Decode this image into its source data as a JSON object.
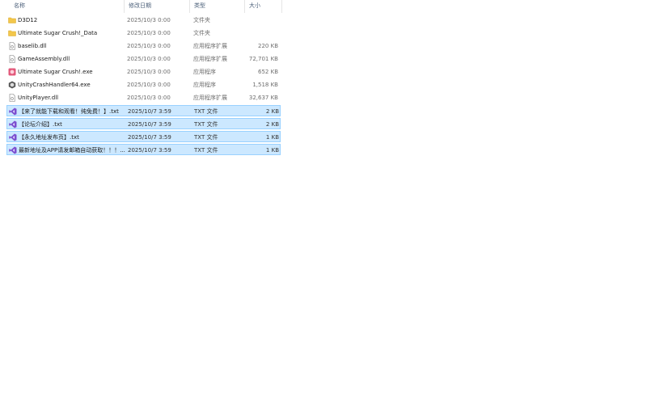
{
  "header": {
    "name": "名称",
    "date": "修改日期",
    "type": "类型",
    "size": "大小"
  },
  "rows": [
    {
      "name": "D3D12",
      "date": "2025/10/3 0:00",
      "type": "文件夹",
      "size": "",
      "icon": "folder-icon",
      "selected": false
    },
    {
      "name": "Ultimate Sugar Crush!_Data",
      "date": "2025/10/3 0:00",
      "type": "文件夹",
      "size": "",
      "icon": "folder-icon",
      "selected": false
    },
    {
      "name": "baselib.dll",
      "date": "2025/10/3 0:00",
      "type": "应用程序扩展",
      "size": "220 KB",
      "icon": "dll-file-icon",
      "selected": false
    },
    {
      "name": "GameAssembly.dll",
      "date": "2025/10/3 0:00",
      "type": "应用程序扩展",
      "size": "72,701 KB",
      "icon": "dll-file-icon",
      "selected": false
    },
    {
      "name": "Ultimate Sugar Crush!.exe",
      "date": "2025/10/3 0:00",
      "type": "应用程序",
      "size": "652 KB",
      "icon": "game-exe-icon",
      "selected": false
    },
    {
      "name": "UnityCrashHandler64.exe",
      "date": "2025/10/3 0:00",
      "type": "应用程序",
      "size": "1,518 KB",
      "icon": "unity-exe-icon",
      "selected": false
    },
    {
      "name": "UnityPlayer.dll",
      "date": "2025/10/3 0:00",
      "type": "应用程序扩展",
      "size": "32,637 KB",
      "icon": "dll-file-icon",
      "selected": false
    },
    {
      "name": "【来了就能下载和观看！纯免费！】.txt",
      "date": "2025/10/7 3:59",
      "type": "TXT 文件",
      "size": "2 KB",
      "icon": "visual-studio-txt-icon",
      "selected": true
    },
    {
      "name": "【论坛介绍】.txt",
      "date": "2025/10/7 3:59",
      "type": "TXT 文件",
      "size": "2 KB",
      "icon": "visual-studio-txt-icon",
      "selected": true
    },
    {
      "name": "【永久地址发布页】.txt",
      "date": "2025/10/7 3:59",
      "type": "TXT 文件",
      "size": "1 KB",
      "icon": "visual-studio-txt-icon",
      "selected": true
    },
    {
      "name": "最新地址及APP请发邮箱自动获取！！！...",
      "date": "2025/10/7 3:59",
      "type": "TXT 文件",
      "size": "1 KB",
      "icon": "visual-studio-txt-icon",
      "selected": true
    }
  ]
}
